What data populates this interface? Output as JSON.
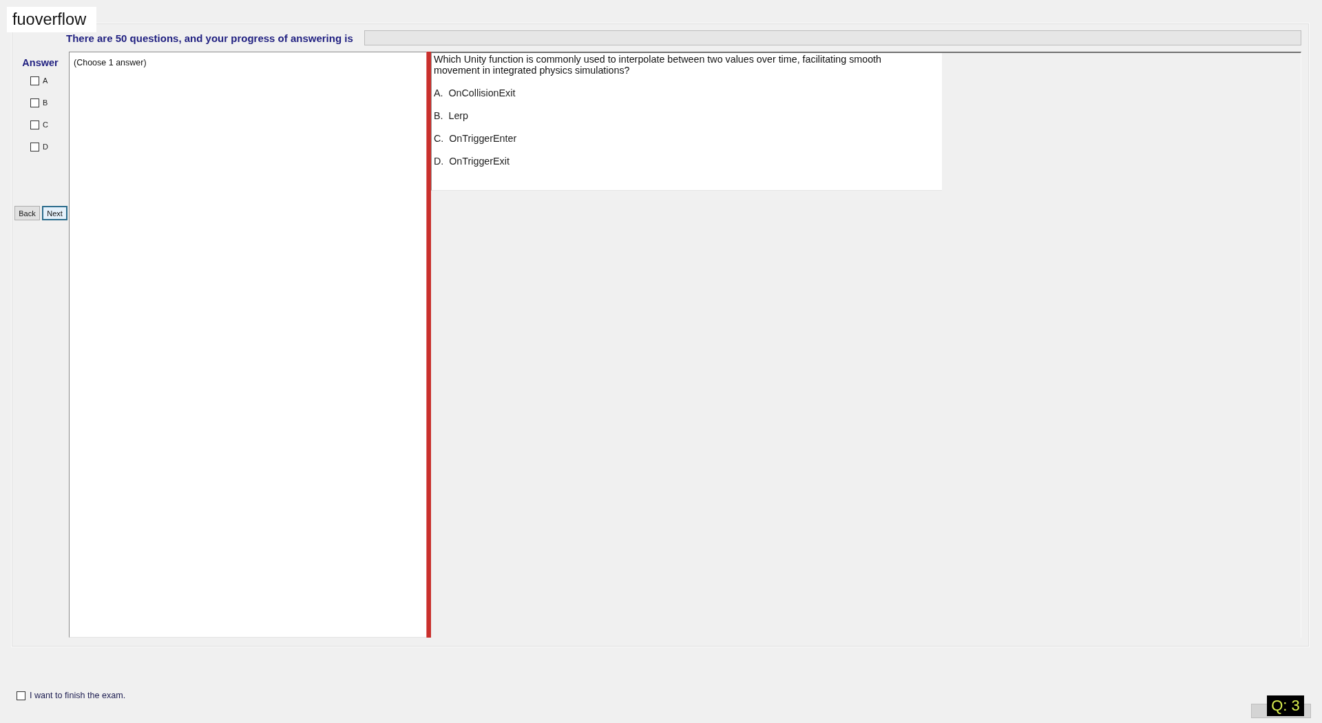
{
  "header": {
    "site_label": "fuoverflow"
  },
  "progress": {
    "text": "There are 50 questions, and your progress of answering is",
    "level": 0
  },
  "answer_panel": {
    "title": "Answer",
    "choices": [
      {
        "label": "A",
        "checked": false
      },
      {
        "label": "B",
        "checked": false
      },
      {
        "label": "C",
        "checked": false
      },
      {
        "label": "D",
        "checked": false
      }
    ],
    "buttons": [
      {
        "label": "Back",
        "focused": false
      },
      {
        "label": "Next",
        "focused": true
      }
    ]
  },
  "hint": "(Choose 1 answer)",
  "question": {
    "text": "Which Unity function is commonly used to interpolate between two values over time, facilitating smooth movement in integrated physics simulations?",
    "options": [
      "A.  OnCollisionExit",
      "B.  Lerp",
      "C.  OnTriggerEnter",
      "D.  OnTriggerExit"
    ]
  },
  "finish": {
    "label": "I want to finish the exam.",
    "checked": false
  },
  "question_badge": "Q: 3"
}
